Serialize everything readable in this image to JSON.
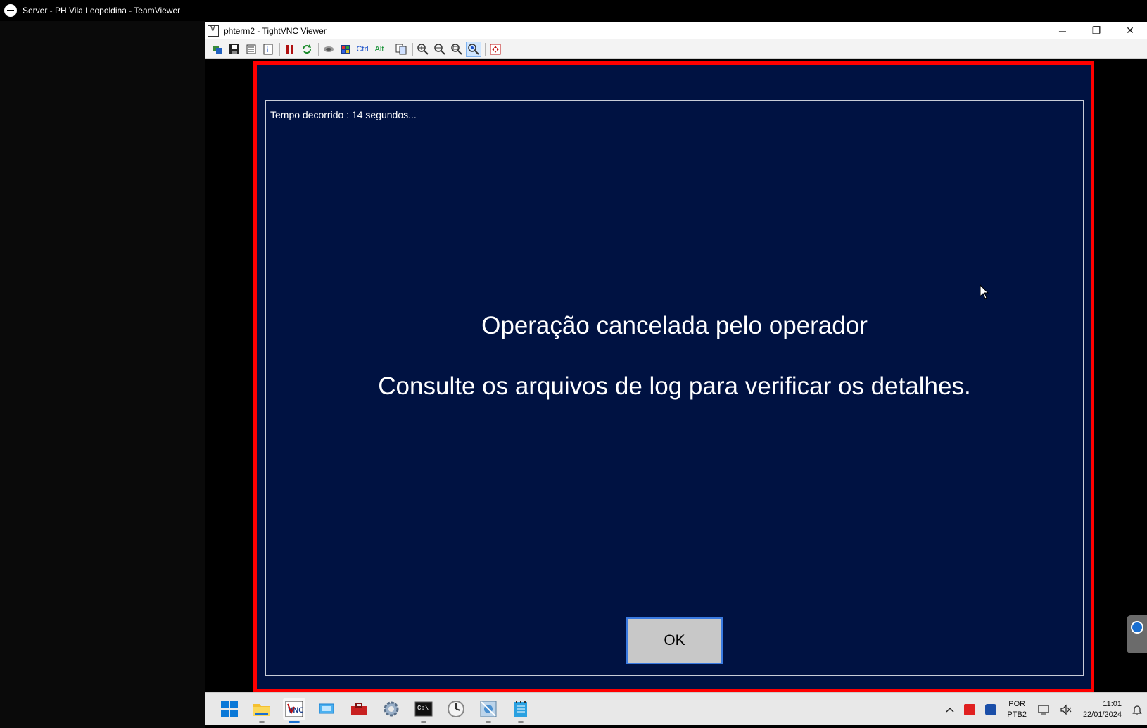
{
  "teamviewer": {
    "title": "Server - PH Vila Leopoldina - TeamViewer"
  },
  "vnc": {
    "title": "phterm2 - TightVNC Viewer",
    "controls": {
      "minimize": "─",
      "restore": "❐",
      "close": "✕"
    },
    "toolbar": {
      "ctrl_label": "Ctrl",
      "alt_label": "Alt"
    }
  },
  "dialog": {
    "elapsed": "Tempo decorrido : 14 segundos...",
    "message_line1": "Operação cancelada pelo operador",
    "message_line2": "Consulte os arquivos de log para verificar os detalhes.",
    "ok_label": "OK"
  },
  "taskbar": {
    "apps": [
      "start",
      "file-explorer",
      "tightvnc",
      "remote-desktop",
      "toolbox",
      "settings",
      "terminal",
      "clock",
      "network-app",
      "notepad"
    ],
    "tray": {
      "lang_line1": "POR",
      "lang_line2": "PTB2",
      "time": "11:01",
      "date": "22/01/2024"
    }
  },
  "colors": {
    "remote_bg": "#001242",
    "frame": "#ff0000",
    "ok_border": "#3a7ae0"
  }
}
